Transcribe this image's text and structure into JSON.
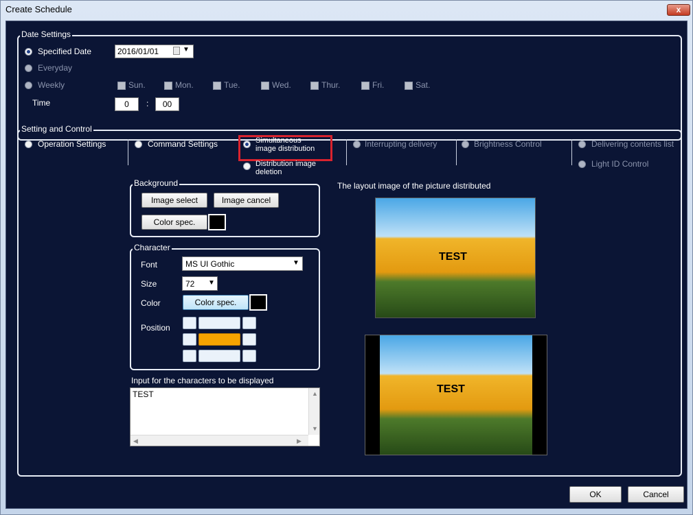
{
  "window": {
    "title": "Create Schedule",
    "close_glyph": "x"
  },
  "date_settings": {
    "label": "Date Settings",
    "specified_date_label": "Specified Date",
    "date_value": "2016/01/01",
    "everyday_label": "Everyday",
    "weekly_label": "Weekly",
    "days": [
      "Sun.",
      "Mon.",
      "Tue.",
      "Wed.",
      "Thur.",
      "Fri.",
      "Sat."
    ],
    "time_label": "Time",
    "hour": "0",
    "time_sep": ":",
    "minute": "00"
  },
  "setting_control": {
    "label": "Setting and Control",
    "options": {
      "operation": "Operation Settings",
      "command": "Command Settings",
      "simultaneous_1": "Simultaneous",
      "simultaneous_2": "image distribution",
      "deletion_1": "Distribution image",
      "deletion_2": "deletion",
      "interrupting": "Interrupting delivery",
      "brightness": "Brightness Control",
      "delivering": "Delivering contents list",
      "light_id": "Light ID Control"
    },
    "selected": "simultaneous",
    "highlight_color": "#d9232e"
  },
  "background": {
    "label": "Background",
    "image_select": "Image select",
    "image_cancel": "Image cancel",
    "color_spec": "Color spec.",
    "swatch_color": "#000000"
  },
  "character": {
    "label": "Character",
    "font_label": "Font",
    "font_value": "MS UI Gothic",
    "size_label": "Size",
    "size_value": "72",
    "color_label": "Color",
    "color_spec": "Color spec.",
    "swatch_color": "#000000",
    "position_label": "Position",
    "position_selected": "middle-center",
    "selected_color": "#f5a300"
  },
  "input": {
    "label": "Input for the characters to be displayed",
    "value": "TEST"
  },
  "preview": {
    "label": "The layout image of the picture distributed",
    "overlay_text": "TEST"
  },
  "footer": {
    "ok": "OK",
    "cancel": "Cancel"
  }
}
